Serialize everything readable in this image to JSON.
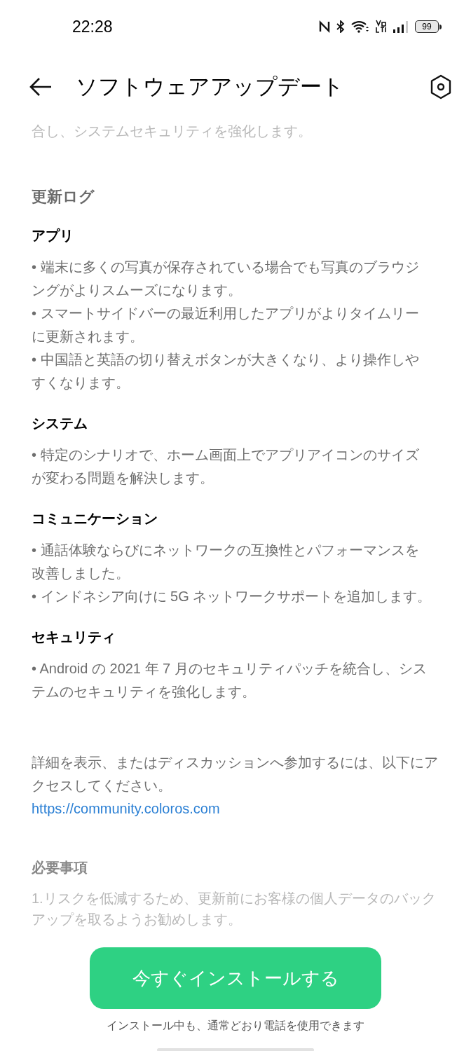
{
  "status_bar": {
    "time": "22:28",
    "battery": "99"
  },
  "header": {
    "title": "ソフトウェアアップデート"
  },
  "faded_top_text": "合し、システムセキュリティを強化します。",
  "changelog": {
    "heading": "更新ログ",
    "sections": [
      {
        "title": "アプリ",
        "items": [
          "• 端末に多くの写真が保存されている場合でも写真のブラウジングがよりスムーズになります。",
          "• スマートサイドバーの最近利用したアプリがよりタイムリーに更新されます。",
          "• 中国語と英語の切り替えボタンが大きくなり、より操作しやすくなります。"
        ]
      },
      {
        "title": "システム",
        "items": [
          "• 特定のシナリオで、ホーム画面上でアプリアイコンのサイズが変わる問題を解決します。"
        ]
      },
      {
        "title": "コミュニケーション",
        "items": [
          "• 通話体験ならびにネットワークの互換性とパフォーマンスを改善しました。",
          "• インドネシア向けに 5G ネットワークサポートを追加します。"
        ]
      },
      {
        "title": "セキュリティ",
        "items": [
          "• Android の 2021 年 7 月のセキュリティパッチを統合し、システムのセキュリティを強化します。"
        ]
      }
    ]
  },
  "details": {
    "text": "詳細を表示、またはディスカッションへ参加するには、以下にアクセスしてください。",
    "link": "https://community.coloros.com"
  },
  "requirements": {
    "heading": "必要事項",
    "faded_text": "1.リスクを低減するため、更新前にお客様の個人データのバックアップを取るようお勧めします。"
  },
  "install_button": "今すぐインストールする",
  "install_note": "インストール中も、通常どおり電話を使用できます"
}
